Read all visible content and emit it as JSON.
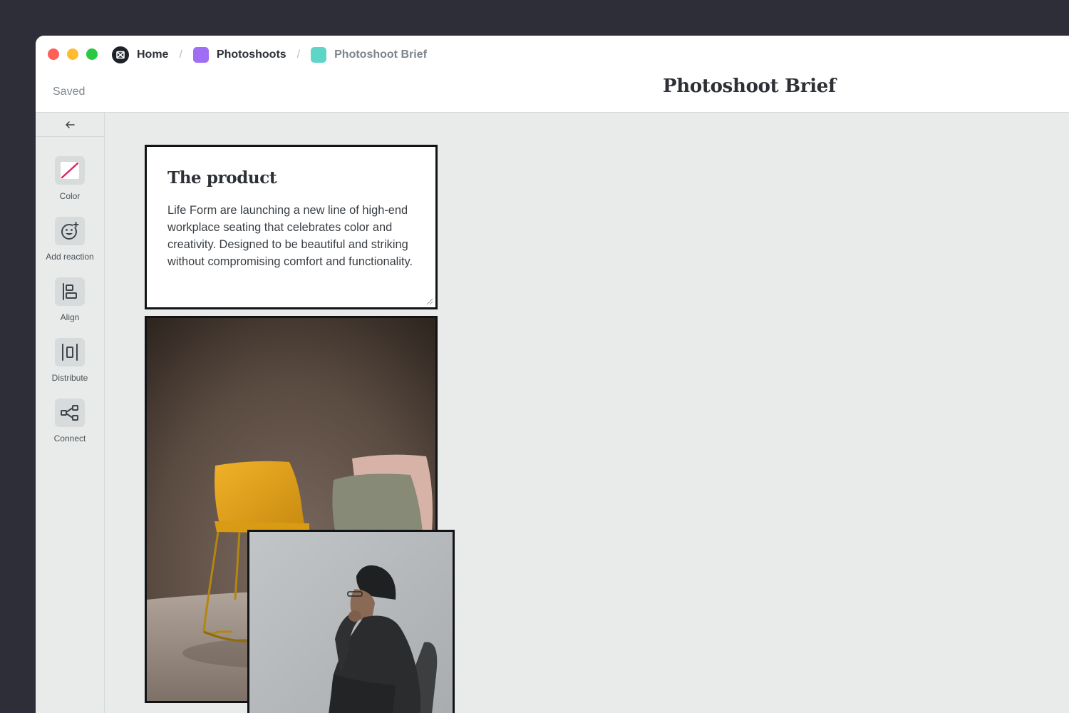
{
  "breadcrumb": {
    "home": "Home",
    "section": "Photoshoots",
    "current": "Photoshoot Brief",
    "separator": "/",
    "colors": {
      "section": "#a06ef5",
      "current": "#5ed6c7"
    }
  },
  "status": {
    "saved": "Saved"
  },
  "document": {
    "title": "Photoshoot Brief"
  },
  "sidebar": {
    "back_icon": "arrow-left-icon",
    "tools": [
      {
        "label": "Color",
        "icon": "color-slash-icon"
      },
      {
        "label": "Add reaction",
        "icon": "add-reaction-icon"
      },
      {
        "label": "Align",
        "icon": "align-left-icon"
      },
      {
        "label": "Distribute",
        "icon": "distribute-icon"
      },
      {
        "label": "Connect",
        "icon": "connect-icon"
      }
    ]
  },
  "canvas": {
    "card": {
      "title": "The product",
      "body": "Life Form are launching a new line of high-end workplace seating that celebrates color and creativity. Designed to be beautiful and striking without compromising comfort and functionality."
    },
    "images": [
      {
        "subject": "chairs-photo"
      },
      {
        "subject": "person-photo"
      }
    ]
  }
}
